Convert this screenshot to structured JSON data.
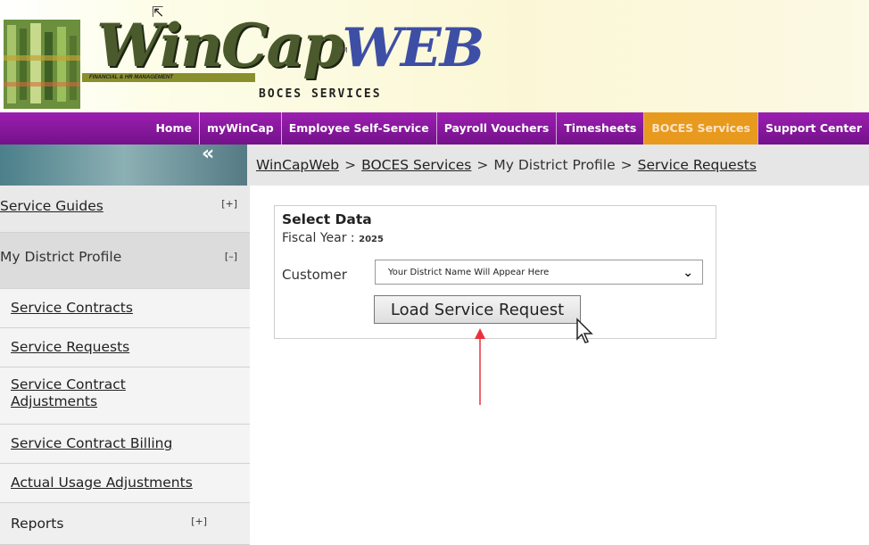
{
  "brand": {
    "name_part1": "WinCap",
    "name_part2": "WEB",
    "tm": "TM",
    "strip": "FINANCIAL & HR MANAGEMENT",
    "subtitle": "BOCES SERVICES"
  },
  "nav": {
    "items": [
      {
        "label": "Home",
        "active": false
      },
      {
        "label": "myWinCap",
        "active": false
      },
      {
        "label": "Employee Self-Service",
        "active": false
      },
      {
        "label": "Payroll Vouchers",
        "active": false
      },
      {
        "label": "Timesheets",
        "active": false
      },
      {
        "label": "BOCES Services",
        "active": true
      },
      {
        "label": "Support Center",
        "active": false
      }
    ]
  },
  "collapse_icon": "«",
  "breadcrumb": {
    "items": [
      "WinCapWeb",
      "BOCES Services",
      "My District Profile",
      "Service Requests"
    ],
    "separator": ">"
  },
  "sidebar": {
    "service_guides": {
      "label": "Service Guides",
      "toggle": "[+]"
    },
    "my_district_profile": {
      "label": "My District Profile",
      "toggle": "[–]"
    },
    "links": [
      "Service Contracts",
      "Service Requests",
      "Service Contract Adjustments",
      "Service Contract Billing",
      "Actual Usage Adjustments"
    ],
    "reports": {
      "label": "Reports",
      "toggle": "[+]"
    }
  },
  "form": {
    "title": "Select Data",
    "fiscal_year_label": "Fiscal Year :",
    "fiscal_year_value": "2025",
    "customer_label": "Customer",
    "customer_value": "Your District Name Will Appear Here",
    "load_button": "Load Service Request"
  },
  "colors": {
    "nav_bg": "#8a18a0",
    "nav_active": "#e79a1d",
    "annotation_arrow": "#e8323c"
  }
}
